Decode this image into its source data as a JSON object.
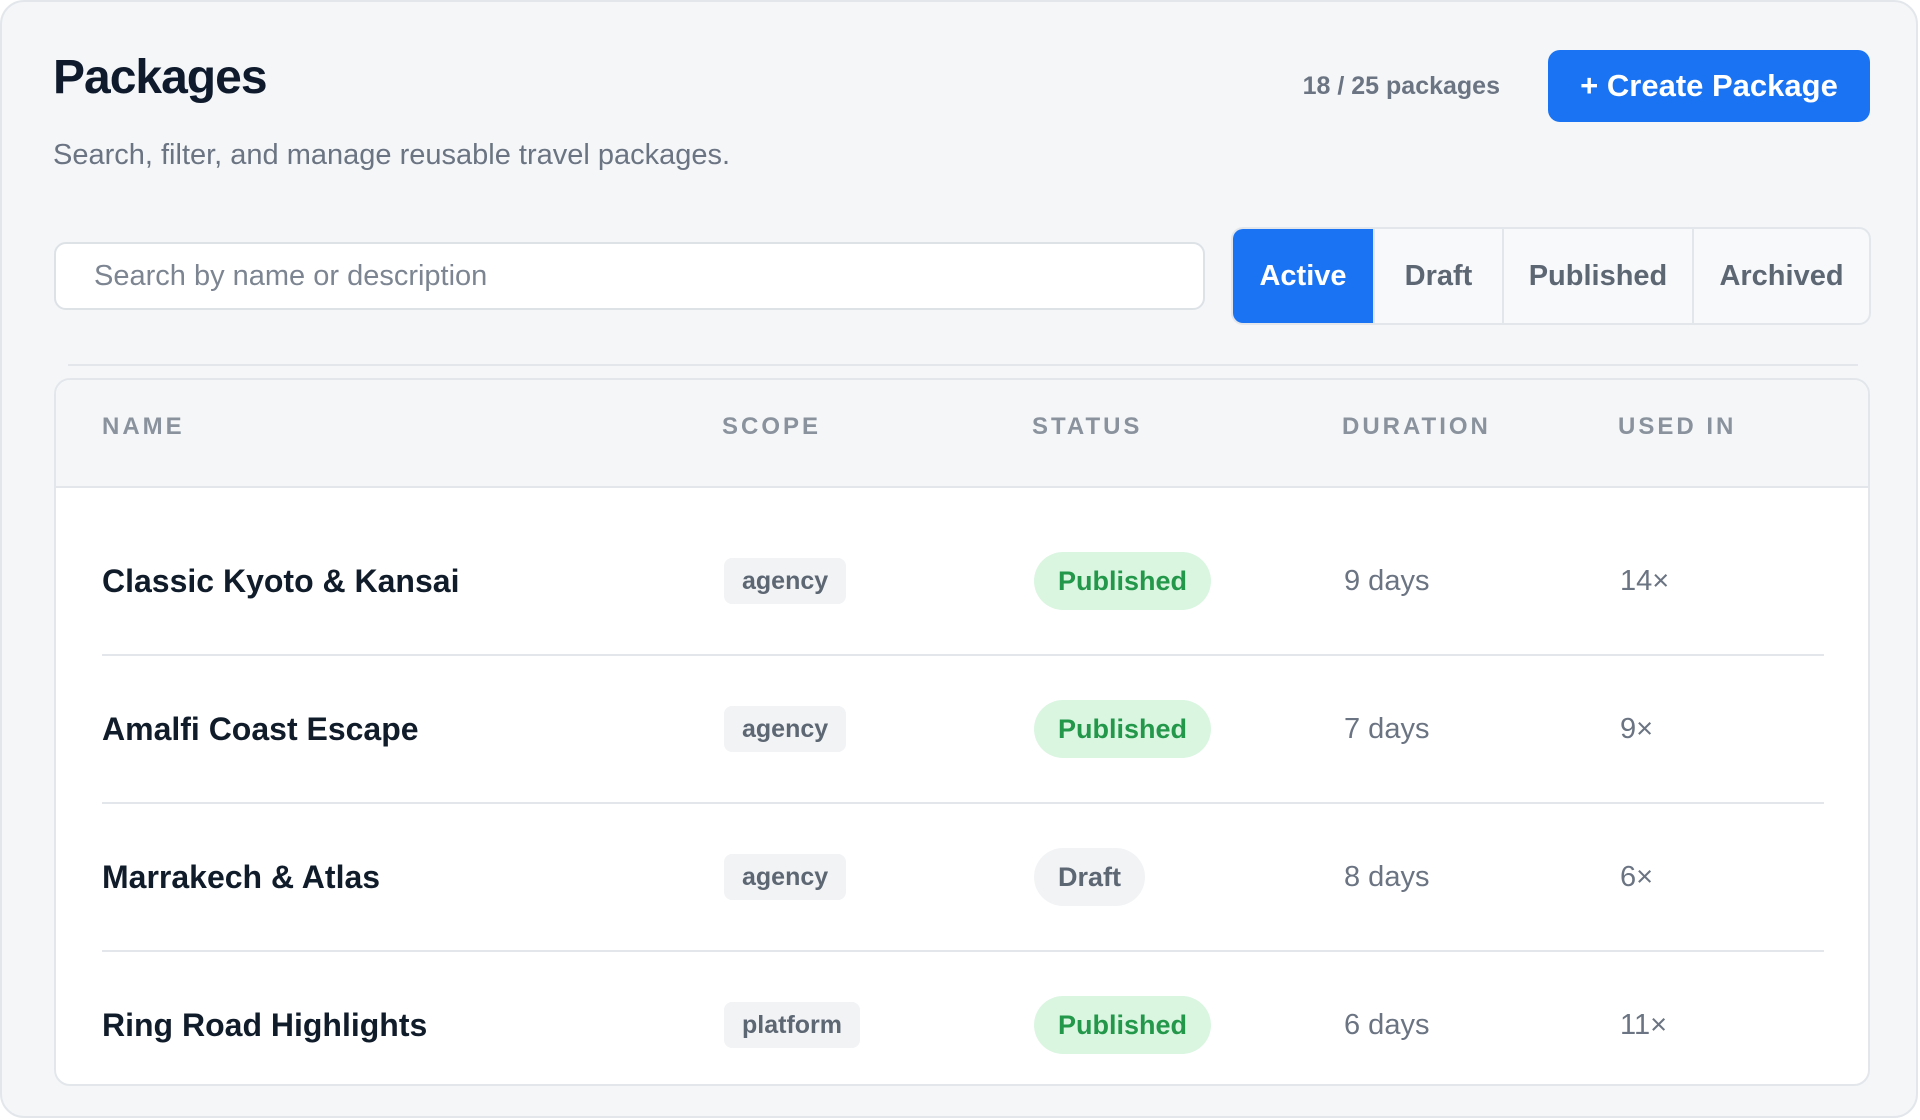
{
  "header": {
    "title": "Packages",
    "subtitle": "Search, filter, and manage reusable travel packages.",
    "count_text": "18 / 25 packages",
    "create_label": "+ Create Package"
  },
  "search": {
    "placeholder": "Search by name or description",
    "value": ""
  },
  "filters": {
    "selected": "Active",
    "items": [
      "Active",
      "Draft",
      "Published",
      "Archived"
    ]
  },
  "table": {
    "columns": [
      "NAME",
      "SCOPE",
      "STATUS",
      "DURATION",
      "USED IN"
    ],
    "rows": [
      {
        "name": "Classic Kyoto & Kansai",
        "scope": "agency",
        "status": "Published",
        "duration": "9 days",
        "used_in": "14×"
      },
      {
        "name": "Amalfi Coast Escape",
        "scope": "agency",
        "status": "Published",
        "duration": "7 days",
        "used_in": "9×"
      },
      {
        "name": "Marrakech & Atlas",
        "scope": "agency",
        "status": "Draft",
        "duration": "8 days",
        "used_in": "6×"
      },
      {
        "name": "Ring Road Highlights",
        "scope": "platform",
        "status": "Published",
        "duration": "6 days",
        "used_in": "11×"
      }
    ]
  },
  "colors": {
    "accent": "#1a73f2",
    "published_bg": "#daf6e1",
    "published_text": "#23974a",
    "draft_bg": "#f1f3f5",
    "draft_text": "#5d6673"
  }
}
